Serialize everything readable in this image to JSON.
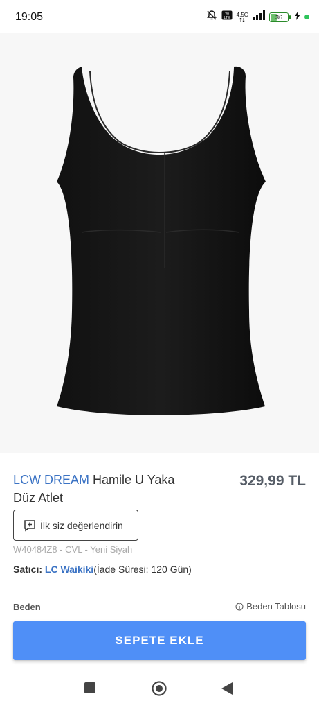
{
  "status_bar": {
    "time": "19:05",
    "network_top": "4.5G",
    "battery_level": "36",
    "battery_fraction": 0.36
  },
  "product": {
    "brand": "LCW DREAM",
    "name": "Hamile U Yaka Düz Atlet",
    "price": "329,99 TL",
    "review_button_label": "İlk siz değerlendirin",
    "code": "W40484Z8 - CVL - Yeni Siyah",
    "seller_label": "Satıcı:",
    "seller_name": "LC Waikiki",
    "return_info": "(İade Süresi: 120 Gün)",
    "size_label": "Beden",
    "size_table_link": "Beden Tablosu",
    "add_to_cart_label": "SEPETE EKLE"
  },
  "colors": {
    "accent": "#4f8ff7",
    "brand_link": "#3b73c4"
  }
}
